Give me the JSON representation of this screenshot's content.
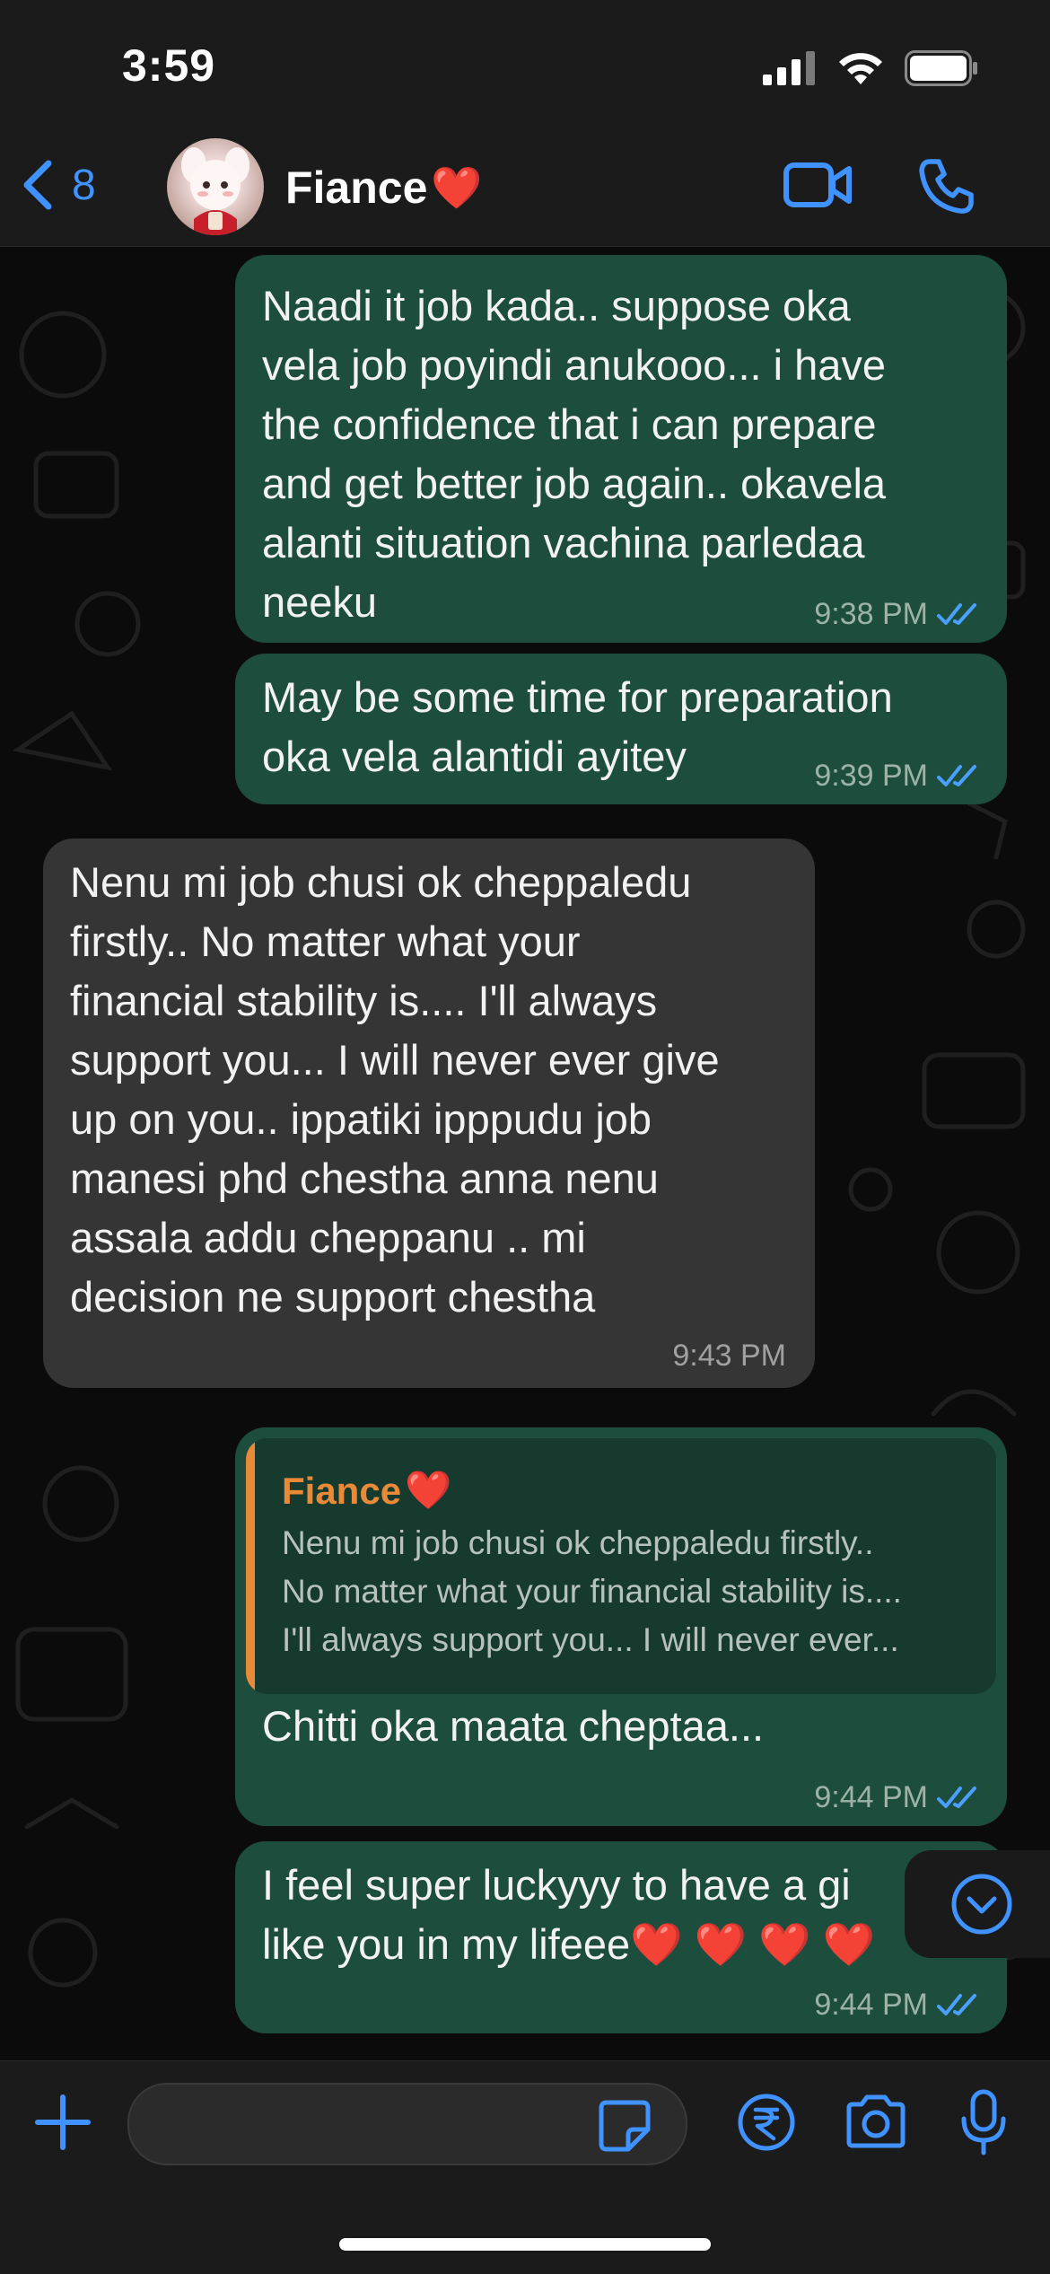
{
  "status_bar": {
    "time": "3:59"
  },
  "header": {
    "back_count": "8",
    "contact_name": "Fiance",
    "heart": "❤️",
    "icons": [
      "chevron-left-icon",
      "video-call-icon",
      "phone-icon"
    ]
  },
  "messages": [
    {
      "type": "outgoing",
      "text": "Naadi it job kada.. suppose oka\nvela job poyindi anukooo... i have\nthe confidence that i can prepare\nand get better job again.. okavela\nalanti situation vachina parledaa\nneeku",
      "time": "9:38 PM",
      "status": "read"
    },
    {
      "type": "outgoing",
      "text": "May be some time for preparation\noka vela alantidi ayitey",
      "time": "9:39 PM",
      "status": "read"
    },
    {
      "type": "incoming",
      "text": "Nenu mi job chusi ok cheppaledu\nfirstly.. No matter what your\nfinancial stability is.... I'll always\nsupport you... I will never ever give\nup on you.. ippatiki ipppudu job\nmanesi phd chestha anna nenu\nassala addu cheppanu .. mi\ndecision ne support chestha",
      "time": "9:43 PM"
    },
    {
      "type": "outgoing",
      "reply_to": {
        "name": "Fiance",
        "heart": "❤️",
        "text": "Nenu mi job chusi ok cheppaledu firstly..\nNo matter what your financial stability is....\nI'll always support you... I will never ever..."
      },
      "text": "Chitti oka maata cheptaa...",
      "time": "9:44 PM",
      "status": "read"
    },
    {
      "type": "outgoing",
      "text": "I feel super luckyyy to have a gi\nlike you in my lifeee❤️ ❤️ ❤️ ❤️",
      "time": "9:44 PM",
      "status": "read"
    }
  ],
  "colors": {
    "accent": "#3f92ff",
    "outgoing_bubble": "#1d4d3c",
    "incoming_bubble": "#353535",
    "reply_name": "#e98a39"
  },
  "composer": {
    "icons": [
      "plus-icon",
      "sticker-icon",
      "rupee-payment-icon",
      "camera-icon",
      "microphone-icon"
    ]
  }
}
